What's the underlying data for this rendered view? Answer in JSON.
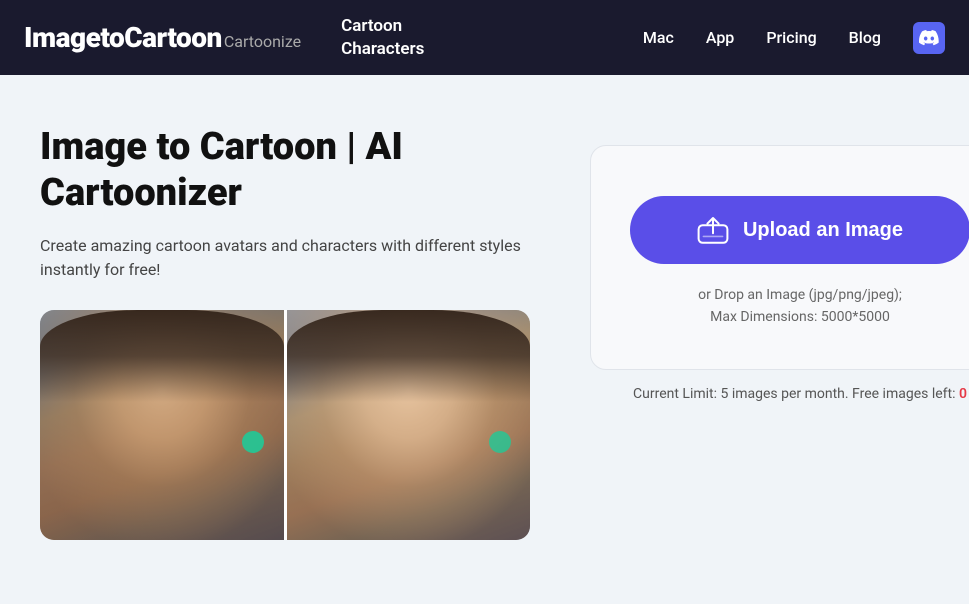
{
  "header": {
    "logo_main": "ImagetoCartoon",
    "logo_sub": "Cartoonize",
    "cartoon_chars_line1": "Cartoon",
    "cartoon_chars_line2": "Characters",
    "nav": {
      "mac": "Mac",
      "app": "App",
      "pricing": "Pricing",
      "blog": "Blog"
    },
    "discord_label": "Discord"
  },
  "main": {
    "title": "Image to Cartoon | AI Cartoonizer",
    "description": "Create amazing cartoon avatars and characters with different styles instantly for free!",
    "upload_button_label": "Upload an Image",
    "drop_hint_line1": "or Drop an Image (jpg/png/jpeg);",
    "drop_hint_line2": "Max Dimensions: 5000*5000",
    "limit_text_prefix": "Current Limit: 5 images per month. Free images left:",
    "limit_number": "0"
  }
}
